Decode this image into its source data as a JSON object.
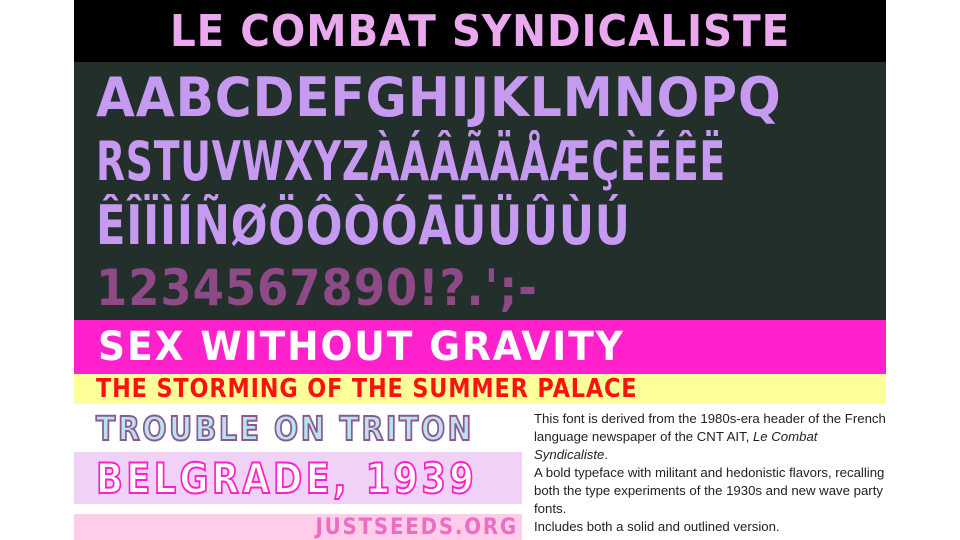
{
  "title": "Le Combat Syndicaliste",
  "glyphs": {
    "row1": "AABCDEFGHIJKLMNOPQ",
    "row2": "RSTUVWXYZÀÁÂÃÄÅÆÇÈÉÊË",
    "row3": "ÊÎÏÌÍÑØÖÔÒÓĀŪÜÛÙÚ",
    "row4": "1234567890!?.';-"
  },
  "samples": {
    "sex_without_gravity": "SEX WITHOUT GRAVITY",
    "storming": "THE STORMING OF THE SUMMER PALACE",
    "triton": "TROUBLE ON TRITON",
    "belgrade": "BELGRADE, 1939",
    "justseeds": "JUSTSEEDS.ORG"
  },
  "description": {
    "line1_pre": "This font is derived from the 1980s-era header of the French language newspaper of the CNT AIT, ",
    "line1_em": "Le Combat Syndicaliste",
    "line1_post": ".",
    "line2": "A bold typeface with militant and hedonistic flavors, recalling both the type experiments of the 1930s and new wave party fonts.",
    "line3": "Includes both a solid and outlined version."
  },
  "colors": {
    "title_bg": "#000000",
    "title_fg": "#eaa8ee",
    "panel_bg": "#222f2b",
    "glyph_fg": "#c79af1",
    "number_fg": "#8d4a86",
    "magenta": "#ff22cc",
    "yellow": "#ffff99",
    "red": "#ff1111"
  }
}
